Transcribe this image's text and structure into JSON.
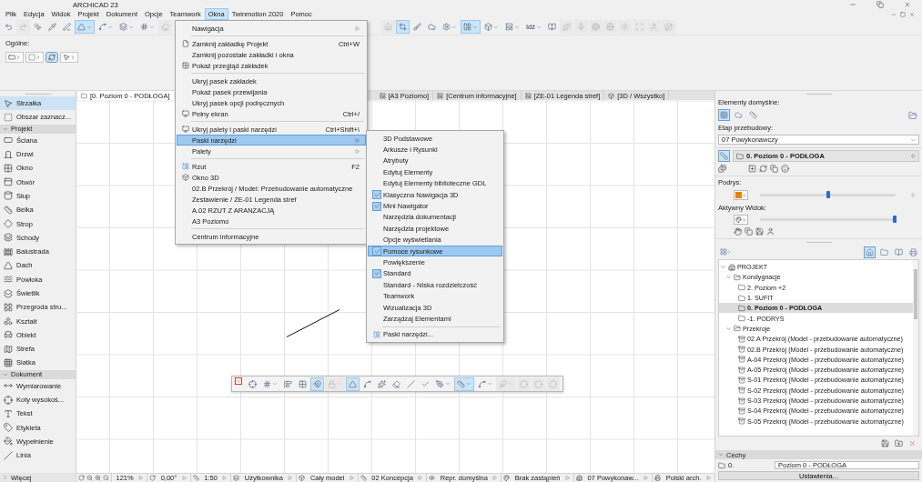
{
  "window": {
    "title": "ARCHICAD 23"
  },
  "menu_bar": [
    {
      "label": "Plik",
      "selected": false
    },
    {
      "label": "Edycja",
      "selected": false
    },
    {
      "label": "Widok",
      "selected": false
    },
    {
      "label": "Projekt",
      "selected": false
    },
    {
      "label": "Dokument",
      "selected": false
    },
    {
      "label": "Opcje",
      "selected": false
    },
    {
      "label": "Teamwork",
      "selected": false
    },
    {
      "label": "Okna",
      "selected": true
    },
    {
      "label": "Twinmotion 2020",
      "selected": false
    },
    {
      "label": "Pomoc",
      "selected": false
    }
  ],
  "toolbar": {
    "left": [
      {
        "kind": "button",
        "selected": false,
        "disabled": false
      },
      {
        "kind": "button",
        "selected": false,
        "disabled": true
      },
      {
        "kind": "button",
        "selected": false,
        "disabled": false
      },
      {
        "kind": "button",
        "selected": false,
        "disabled": false
      },
      {
        "kind": "button",
        "selected": false,
        "disabled": false
      },
      {
        "kind": "split",
        "selected": true,
        "disabled": false
      },
      {
        "kind": "split",
        "selected": false,
        "disabled": false
      },
      {
        "kind": "split",
        "selected": false,
        "disabled": false
      },
      {
        "kind": "split",
        "selected": false,
        "disabled": false
      },
      {
        "kind": "button",
        "selected": false,
        "disabled": true
      }
    ],
    "right": [
      {
        "kind": "button",
        "selected": false,
        "disabled": true
      },
      {
        "kind": "button",
        "selected": true,
        "disabled": false
      },
      {
        "kind": "button",
        "selected": false,
        "disabled": false
      },
      {
        "kind": "button",
        "selected": false,
        "disabled": false
      },
      {
        "kind": "split",
        "selected": false,
        "disabled": false
      },
      {
        "kind": "split",
        "selected": true,
        "disabled": false
      },
      {
        "kind": "split",
        "selected": false,
        "disabled": false
      },
      {
        "kind": "split",
        "selected": false,
        "disabled": false
      },
      {
        "kind": "text",
        "label": "Idź",
        "selected": false,
        "disabled": false
      },
      {
        "kind": "button",
        "selected": false,
        "disabled": false
      },
      {
        "kind": "button",
        "selected": false,
        "disabled": true
      },
      {
        "kind": "button",
        "selected": false,
        "disabled": true
      },
      {
        "kind": "button",
        "selected": false,
        "disabled": true
      },
      {
        "kind": "button",
        "selected": false,
        "disabled": true
      },
      {
        "kind": "button",
        "selected": false,
        "disabled": true
      },
      {
        "kind": "button",
        "selected": false,
        "disabled": true
      },
      {
        "kind": "button",
        "selected": false,
        "disabled": true
      },
      {
        "kind": "button",
        "selected": false,
        "disabled": true
      }
    ]
  },
  "info_box": {
    "label": "Ogólne:",
    "buttons": [
      {
        "kind": "split",
        "selected": false
      },
      {
        "kind": "split",
        "selected": false
      },
      {
        "kind": "button",
        "selected": true
      },
      {
        "kind": "split",
        "selected": false
      }
    ]
  },
  "tabs": [
    {
      "label": "[0. Poziom 0 - PODŁOGA]",
      "selected": true
    },
    {
      "label": "[A3 Poziomo]",
      "selected": false
    },
    {
      "label": "[Centrum informacyjne]",
      "selected": false
    },
    {
      "label": "[ZE-01 Legenda stref]",
      "selected": false
    },
    {
      "label": "[3D / Wszystko]",
      "selected": false
    }
  ],
  "toolbox": {
    "tools": [
      {
        "label": "Strzałka",
        "selected": true
      },
      {
        "label": "Obszar zaznacz...",
        "selected": false
      }
    ],
    "groups": [
      {
        "title": "Projekt",
        "expanded": true,
        "tools": [
          {
            "label": "Ściana",
            "selected": false
          },
          {
            "label": "Drzwi",
            "selected": false
          },
          {
            "label": "Okno",
            "selected": false
          },
          {
            "label": "Otwór",
            "selected": false
          },
          {
            "label": "Słup",
            "selected": false
          },
          {
            "label": "Belka",
            "selected": false
          },
          {
            "label": "Strop",
            "selected": false
          },
          {
            "label": "Schody",
            "selected": false
          },
          {
            "label": "Balustrada",
            "selected": false
          },
          {
            "label": "Dach",
            "selected": false
          },
          {
            "label": "Powłoka",
            "selected": false
          },
          {
            "label": "Świetlik",
            "selected": false
          },
          {
            "label": "Przegroda stru...",
            "selected": false
          },
          {
            "label": "Kształt",
            "selected": false
          },
          {
            "label": "Obiekt",
            "selected": false
          },
          {
            "label": "Strefa",
            "selected": false
          },
          {
            "label": "Siatka",
            "selected": false
          }
        ]
      },
      {
        "title": "Dokument",
        "expanded": true,
        "tools": [
          {
            "label": "Wymiarowanie",
            "selected": false
          },
          {
            "label": "Koty wysokoś...",
            "selected": false
          },
          {
            "label": "Tekst",
            "selected": false
          },
          {
            "label": "Etykieta",
            "selected": false
          },
          {
            "label": "Wypełnienie",
            "selected": false
          },
          {
            "label": "Linia",
            "selected": false
          }
        ]
      }
    ],
    "more": {
      "label": "Więcej",
      "expanded": false
    }
  },
  "window_menu": {
    "items": [
      {
        "kind": "submenu",
        "label": "Nawigacja",
        "selected": false
      },
      {
        "kind": "separator"
      },
      {
        "kind": "item",
        "label": "Zamknij zakładkę Projekt",
        "shortcut": "Ctrl+W",
        "selected": false
      },
      {
        "kind": "item",
        "label": "Zamknij pozostałe zakładki i okna",
        "selected": false
      },
      {
        "kind": "item",
        "label": "Pokaż przegląd zakładek",
        "selected": false
      },
      {
        "kind": "separator"
      },
      {
        "kind": "item",
        "label": "Ukryj pasek zakładek",
        "selected": false
      },
      {
        "kind": "item",
        "label": "Pokaż pasek przewijania",
        "selected": false
      },
      {
        "kind": "item",
        "label": "Ukryj pasek opcji podręcznych",
        "selected": false
      },
      {
        "kind": "item",
        "label": "Pełny ekran",
        "shortcut": "Ctrl+/",
        "selected": false
      },
      {
        "kind": "separator"
      },
      {
        "kind": "item",
        "label": "Ukryj palety i paski narzędzi",
        "shortcut": "Ctrl+Shift+\\",
        "selected": false
      },
      {
        "kind": "submenu",
        "label": "Paski narzędzi",
        "selected": true
      },
      {
        "kind": "submenu",
        "label": "Palety",
        "selected": false
      },
      {
        "kind": "separator"
      },
      {
        "kind": "item",
        "label": "Rzut",
        "shortcut": "F2",
        "selected": false
      },
      {
        "kind": "item",
        "label": "Okno 3D",
        "selected": false
      },
      {
        "kind": "item",
        "label": "02.B Przekrój / Model: Przebudowanie automatyczne",
        "selected": false
      },
      {
        "kind": "item",
        "label": "Zestawienie / ZE-01 Legenda stref",
        "selected": false
      },
      {
        "kind": "item",
        "label": "A.02 RZUT Z ARANŻACJĄ",
        "selected": false
      },
      {
        "kind": "item",
        "label": "A3 Poziomo",
        "selected": false
      },
      {
        "kind": "separator"
      },
      {
        "kind": "item",
        "label": "Centrum informacyjne",
        "selected": false
      }
    ]
  },
  "toolbars_submenu": {
    "items": [
      {
        "kind": "item",
        "label": "3D Podstawowe",
        "checked": false,
        "selected": false
      },
      {
        "kind": "item",
        "label": "Arkusze i Rysunki",
        "checked": false,
        "selected": false
      },
      {
        "kind": "item",
        "label": "Atrybuty",
        "checked": false,
        "selected": false
      },
      {
        "kind": "item",
        "label": "Edytuj Elementy",
        "checked": false,
        "selected": false
      },
      {
        "kind": "item",
        "label": "Edytuj Elementy biblioteczne GDL",
        "checked": false,
        "selected": false
      },
      {
        "kind": "item",
        "label": "Klasyczna Nawigacja 3D",
        "checked": true,
        "selected": false
      },
      {
        "kind": "item",
        "label": "Mini Nawigator",
        "checked": true,
        "selected": false
      },
      {
        "kind": "item",
        "label": "Narzędzia dokumentacji",
        "checked": false,
        "selected": false
      },
      {
        "kind": "item",
        "label": "Narzędzia projektowe",
        "checked": false,
        "selected": false
      },
      {
        "kind": "item",
        "label": "Opcje wyświetlania",
        "checked": false,
        "selected": false
      },
      {
        "kind": "item",
        "label": "Pomoce rysunkowe",
        "checked": true,
        "selected": true
      },
      {
        "kind": "item",
        "label": "Powiększenie",
        "checked": false,
        "selected": false
      },
      {
        "kind": "item",
        "label": "Standard",
        "checked": true,
        "selected": false
      },
      {
        "kind": "item",
        "label": "Standard - Niska rozdzielczość",
        "checked": false,
        "selected": false
      },
      {
        "kind": "item",
        "label": "Teamwork",
        "checked": false,
        "selected": false
      },
      {
        "kind": "item",
        "label": "Wizualizacja 3D",
        "checked": false,
        "selected": false
      },
      {
        "kind": "item",
        "label": "Zarządzaj Elementami",
        "checked": false,
        "selected": false
      },
      {
        "kind": "separator"
      },
      {
        "kind": "icon_item",
        "label": "Paski narzędzi...",
        "checked": false,
        "selected": false
      }
    ]
  },
  "floating_toolbar": {
    "buttons": [
      {
        "kind": "button",
        "selected": false,
        "disabled": false
      },
      {
        "kind": "split",
        "selected": false,
        "disabled": false
      },
      {
        "kind": "button",
        "selected": false,
        "disabled": false
      },
      {
        "kind": "button",
        "selected": false,
        "disabled": false
      },
      {
        "kind": "button",
        "selected": true,
        "disabled": false
      },
      {
        "kind": "split",
        "selected": false,
        "disabled": true
      },
      {
        "kind": "button",
        "selected": true,
        "disabled": false
      },
      {
        "kind": "button",
        "selected": false,
        "disabled": false
      },
      {
        "kind": "button",
        "selected": false,
        "disabled": false
      },
      {
        "kind": "button",
        "selected": false,
        "disabled": false
      },
      {
        "kind": "button",
        "selected": false,
        "disabled": false
      },
      {
        "kind": "button",
        "selected": false,
        "disabled": false
      },
      {
        "kind": "split",
        "selected": false,
        "disabled": false
      },
      {
        "kind": "split",
        "selected": true,
        "disabled": false
      },
      {
        "kind": "split",
        "selected": false,
        "disabled": false
      },
      {
        "kind": "split",
        "selected": false,
        "disabled": true
      },
      {
        "kind": "button",
        "selected": false,
        "disabled": true
      },
      {
        "kind": "button",
        "selected": false,
        "disabled": true
      },
      {
        "kind": "button",
        "selected": false,
        "disabled": true
      }
    ]
  },
  "defaults_panel": {
    "title": "Elementy domyślne:",
    "buttons": [
      {
        "selected": true
      },
      {
        "selected": false
      },
      {
        "selected": false
      }
    ],
    "phase_label": "Etap przebudowy:",
    "phase_value": "07 Powykonawczy"
  },
  "navigator_header": {
    "view_selected": true,
    "level_name": "0. Poziom 0 - PODŁOGA"
  },
  "trace": {
    "label": "Podrys:",
    "level": 0.5
  },
  "active_view": {
    "label": "Aktywny Widok:",
    "level": 1.0
  },
  "navigator_tabs": [
    {
      "selected": true
    },
    {
      "selected": false
    },
    {
      "selected": false
    },
    {
      "selected": false
    }
  ],
  "tree": [
    {
      "kind": "project",
      "label": "PROJEKT",
      "expanded": true,
      "selected": false,
      "children": [
        {
          "kind": "group",
          "label": "Kondygnacje",
          "expanded": true,
          "selected": false,
          "children": [
            {
              "kind": "story",
              "label": "2. Poziom +2",
              "selected": false
            },
            {
              "kind": "story",
              "label": "1. SUFIT",
              "selected": false
            },
            {
              "kind": "story",
              "label": "0. Poziom 0 - PODŁOGA",
              "selected": true
            },
            {
              "kind": "story",
              "label": "-1. PODRYS",
              "selected": false
            }
          ]
        },
        {
          "kind": "group",
          "label": "Przekroje",
          "expanded": true,
          "selected": false,
          "children": [
            {
              "kind": "section",
              "label": "02.A Przekrój (Model - przebudowanie automatyczne)",
              "selected": false
            },
            {
              "kind": "section",
              "label": "02.B Przekrój (Model - przebudowanie automatyczne)",
              "selected": false
            },
            {
              "kind": "section",
              "label": "A-04 Przekrój (Model - przebudowanie automatyczne)",
              "selected": false
            },
            {
              "kind": "section",
              "label": "A-05 Przekrój (Model - przebudowanie automatyczne)",
              "selected": false
            },
            {
              "kind": "section",
              "label": "S-01 Przekrój (Model - przebudowanie automatyczne)",
              "selected": false
            },
            {
              "kind": "section",
              "label": "S-02 Przekrój (Model - przebudowanie automatyczne)",
              "selected": false
            },
            {
              "kind": "section",
              "label": "S-03 Przekrój (Model - przebudowanie automatyczne)",
              "selected": false
            },
            {
              "kind": "section",
              "label": "S-04 Przekrój (Model - przebudowanie automatyczne)",
              "selected": false
            },
            {
              "kind": "section",
              "label": "S-05 Przekrój (Model - przebudowanie automatyczne)",
              "selected": false
            }
          ]
        }
      ]
    }
  ],
  "properties": {
    "title": "Cechy",
    "expanded": true,
    "number": "0.",
    "name": "Poziom 0 - PODŁOGA",
    "button": "Ustawienia..."
  },
  "status_bar": {
    "zoom": "121%",
    "angle": "0,00°",
    "scale": "1:50",
    "items": [
      "Użytkownika",
      "Cały model",
      "02 Koncepcja",
      "Repr. domyślna",
      "Brak zastąpień",
      "07 Powykonaw...",
      "Polski arch."
    ]
  }
}
